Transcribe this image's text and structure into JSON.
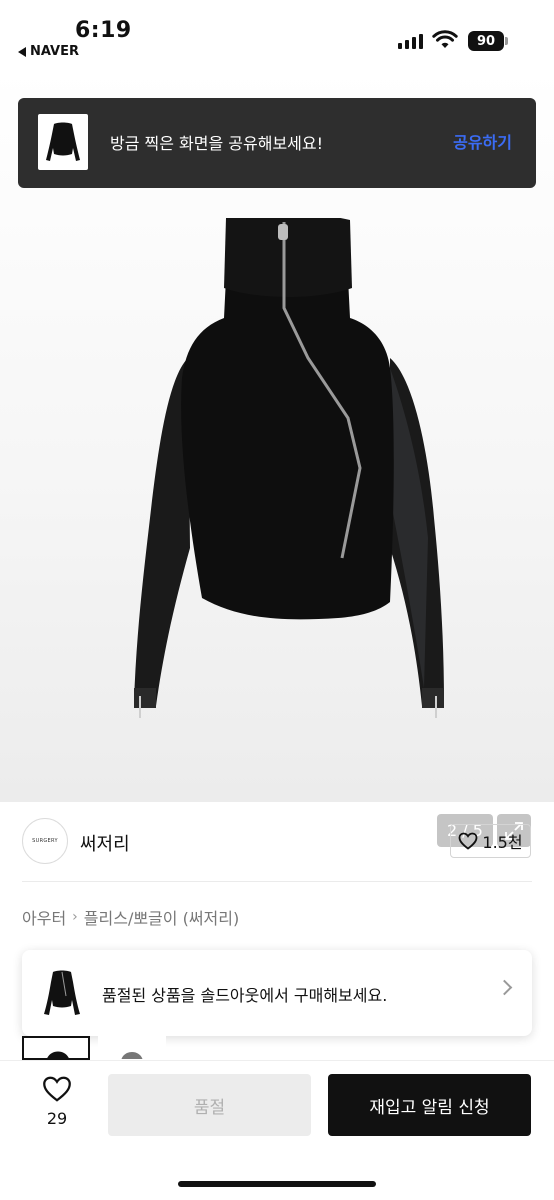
{
  "status_bar": {
    "time": "6:19",
    "back_app": "NAVER",
    "battery": "90"
  },
  "share_toast": {
    "message": "방금 찍은 화면을 공유해보세요!",
    "action": "공유하기"
  },
  "gallery": {
    "counter": "2 / 5"
  },
  "store": {
    "name": "써저리",
    "logo_text": "SURGERY",
    "favorites": "1.5천"
  },
  "breadcrumb": {
    "category": "아우터",
    "subcategory": "플리스/뽀글이 (써저리)"
  },
  "product": {
    "title_peek": ""
  },
  "soldout_banner": {
    "message": "품절된 상품을 솔드아웃에서 구매해보세요."
  },
  "bottom_bar": {
    "likes": "29",
    "soldout_label": "품절",
    "restock_label": "재입고 알림 신청"
  },
  "colors": {
    "toast_bg": "#2e2e2e",
    "toast_action": "#3b6cf5",
    "primary_button": "#111111",
    "disabled_button": "#ececec"
  }
}
